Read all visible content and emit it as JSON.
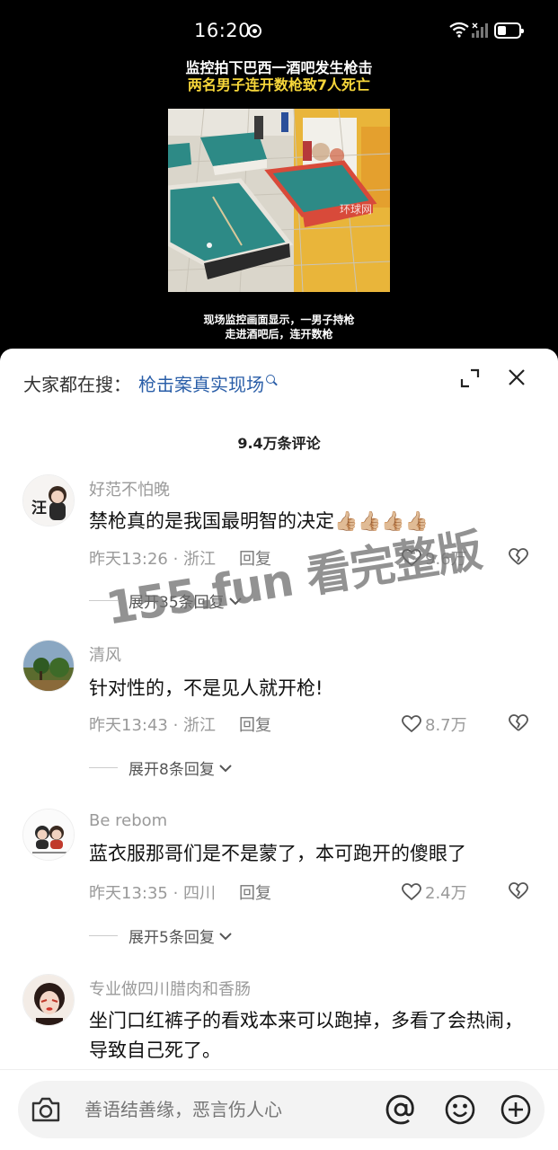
{
  "status": {
    "time": "16:20"
  },
  "video": {
    "title_line1": "监控拍下巴西一酒吧发生枪击",
    "title_line2": "两名男子连开数枪致7人死亡",
    "source_watermark": "环球网",
    "caption_line1": "现场监控画面显示，一男子持枪",
    "caption_line2": "走进酒吧后，连开数枪"
  },
  "search": {
    "label": "大家都在搜：",
    "term": "枪击案真实现场"
  },
  "comment_count": "9.4万条评论",
  "comments": [
    {
      "user": "好范不怕晚",
      "text": "禁枪真的是我国最明智的决定👍🏼👍🏼👍🏼👍🏼",
      "time": "昨天13:26",
      "sep": " · ",
      "location": "浙江",
      "reply": "回复",
      "likes": "9.6万",
      "expand": "展开35条回复",
      "avatar_text": "汪"
    },
    {
      "user": "清风",
      "text": "针对性的，不是见人就开枪!",
      "time": "昨天13:43",
      "sep": " · ",
      "location": "浙江",
      "reply": "回复",
      "likes": "8.7万",
      "expand": "展开8条回复"
    },
    {
      "user": "Be rebom",
      "text": "蓝衣服那哥们是不是蒙了，本可跑开的傻眼了",
      "time": "昨天13:35",
      "sep": " · ",
      "location": "四川",
      "reply": "回复",
      "likes": "2.4万",
      "expand": "展开5条回复"
    },
    {
      "user": "专业做四川腊肉和香肠",
      "text": "坐门口红裤子的看戏本来可以跑掉，多看了会热闹，导致自己死了。"
    }
  ],
  "watermark": "155.fun 看完整版",
  "input": {
    "placeholder": "善语结善缘，恶言伤人心"
  }
}
